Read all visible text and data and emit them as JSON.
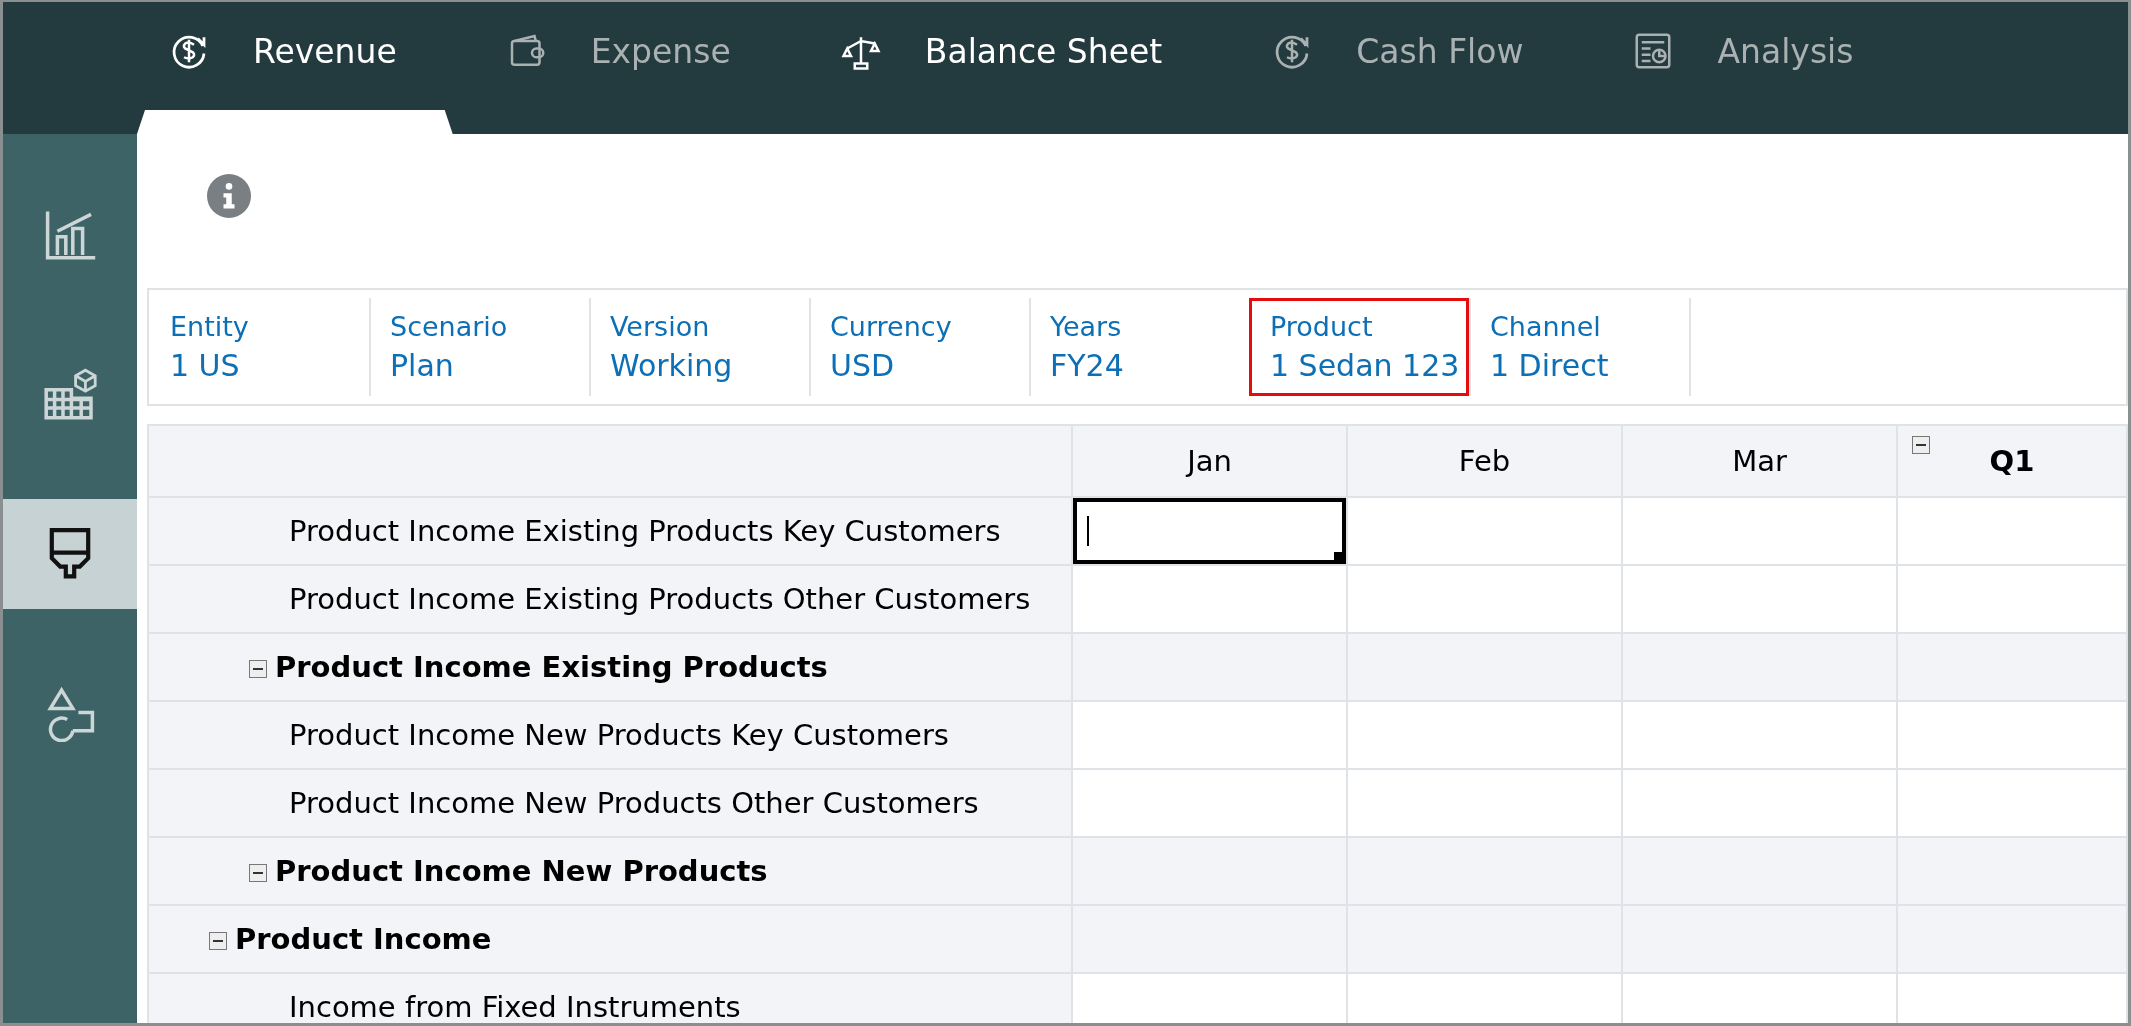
{
  "nav_tabs": [
    {
      "label": "Revenue",
      "selected": true,
      "disabled": false
    },
    {
      "label": "Expense",
      "selected": false,
      "disabled": true
    },
    {
      "label": "Balance Sheet",
      "selected": false,
      "disabled": false
    },
    {
      "label": "Cash Flow",
      "selected": false,
      "disabled": true
    },
    {
      "label": "Analysis",
      "selected": false,
      "disabled": true
    }
  ],
  "sidebar": {
    "items": [
      {
        "selected": false
      },
      {
        "selected": false
      },
      {
        "selected": true
      },
      {
        "selected": false
      }
    ]
  },
  "pov": [
    {
      "dimension": "Entity",
      "member": "1 US",
      "highlighted": false
    },
    {
      "dimension": "Scenario",
      "member": "Plan",
      "highlighted": false
    },
    {
      "dimension": "Version",
      "member": "Working",
      "highlighted": false
    },
    {
      "dimension": "Currency",
      "member": "USD",
      "highlighted": false
    },
    {
      "dimension": "Years",
      "member": "FY24",
      "highlighted": false
    },
    {
      "dimension": "Product",
      "member": "1 Sedan 123",
      "highlighted": true
    },
    {
      "dimension": "Channel",
      "member": "1 Direct",
      "highlighted": false
    }
  ],
  "grid": {
    "columns": [
      {
        "label": "Jan",
        "kind": "period",
        "expanded": false
      },
      {
        "label": "Feb",
        "kind": "period",
        "expanded": false
      },
      {
        "label": "Mar",
        "kind": "period",
        "expanded": false
      },
      {
        "label": "Q1",
        "kind": "total",
        "expanded": true
      }
    ],
    "rows": [
      {
        "label": "Product Income",
        "expanded": true,
        "children": [
          {
            "label": "Product Income Existing Products",
            "expanded": true,
            "children": [
              {
                "label": "Product Income Existing Products Key Customers",
                "cells": [
                  {
                    "selected": true
                  },
                  {
                    "selected": false
                  },
                  {
                    "selected": false
                  },
                  {
                    "selected": false
                  }
                ]
              },
              {
                "label": "Product Income Existing Products Other Customers",
                "cells": [
                  {
                    "selected": false
                  },
                  {
                    "selected": false
                  },
                  {
                    "selected": false
                  },
                  {
                    "selected": false
                  }
                ]
              }
            ],
            "cells": [
              {
                "selected": false
              },
              {
                "selected": false
              },
              {
                "selected": false
              },
              {
                "selected": false
              }
            ]
          },
          {
            "label": "Product Income New Products",
            "expanded": true,
            "children": [
              {
                "label": "Product Income New Products Key Customers",
                "cells": [
                  {
                    "selected": false
                  },
                  {
                    "selected": false
                  },
                  {
                    "selected": false
                  },
                  {
                    "selected": false
                  }
                ]
              },
              {
                "label": "Product Income New Products Other Customers",
                "cells": [
                  {
                    "selected": false
                  },
                  {
                    "selected": false
                  },
                  {
                    "selected": false
                  },
                  {
                    "selected": false
                  }
                ]
              }
            ],
            "cells": [
              {
                "selected": false
              },
              {
                "selected": false
              },
              {
                "selected": false
              },
              {
                "selected": false
              }
            ]
          }
        ],
        "cells": [
          {
            "selected": false
          },
          {
            "selected": false
          },
          {
            "selected": false
          },
          {
            "selected": false
          }
        ]
      },
      {
        "label": "Income from Fixed Instruments",
        "cells": [
          {
            "selected": false
          },
          {
            "selected": false
          },
          {
            "selected": false
          },
          {
            "selected": false
          }
        ]
      }
    ]
  }
}
